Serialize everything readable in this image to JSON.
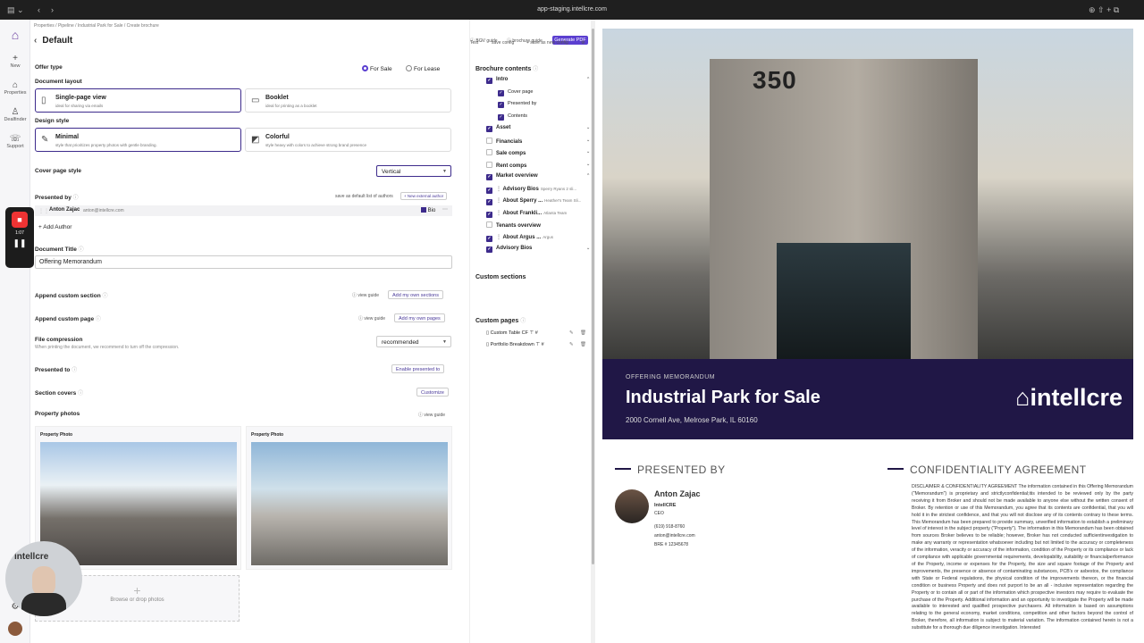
{
  "browser": {
    "url": "app-staging.intellcre.com"
  },
  "sidebar": {
    "items": [
      {
        "label": "New",
        "icon": "plus-icon"
      },
      {
        "label": "Properties",
        "icon": "house-icon"
      },
      {
        "label": "Dealfinder",
        "icon": "person-icon"
      },
      {
        "label": "Support",
        "icon": "support-icon"
      }
    ]
  },
  "recorder": {
    "time": "1:07"
  },
  "webcam": {
    "brand": "intellcre"
  },
  "breadcrumb": "Properties  /  Pipeline  /  Industrial Park for Sale  /  Create brochure",
  "title": "Default",
  "offer_type": {
    "label": "Offer type",
    "options": [
      "For Sale",
      "For Lease"
    ]
  },
  "document_layout": {
    "label": "Document layout",
    "options": [
      {
        "title": "Single-page view",
        "sub": "ideal for sharing via emails"
      },
      {
        "title": "Booklet",
        "sub": "ideal for printing as a booklet"
      }
    ]
  },
  "design_style": {
    "label": "Design style",
    "options": [
      {
        "title": "Minimal",
        "sub": "style that prioritizes property photos with gentle branding."
      },
      {
        "title": "Colorful",
        "sub": "style heavy with colors to achieve strong brand presence"
      }
    ]
  },
  "cover_page_style": {
    "label": "Cover page style",
    "value": "Vertical"
  },
  "presented_by": {
    "label": "Presented by",
    "save_default": "save as default list of authors",
    "new_external": "+ New external author",
    "author_name": "Anton Zajac",
    "author_email": "anton@intellcre.com",
    "bio": "Bio",
    "add_author": "+ Add Author"
  },
  "document_title": {
    "label": "Document Title",
    "value": "Offering Memorandum"
  },
  "append_section": {
    "label": "Append custom section",
    "guide": "view guide",
    "button": "Add my own sections"
  },
  "append_page": {
    "label": "Append custom page",
    "guide": "view guide",
    "button": "Add my own pages"
  },
  "file_compression": {
    "label": "File compression",
    "sub": "When printing the document, we recommend to turn off the compression.",
    "value": "recommended"
  },
  "presented_to": {
    "label": "Presented to",
    "button": "Enable presented to"
  },
  "section_covers": {
    "label": "Section covers",
    "button": "Customize"
  },
  "property_photos": {
    "label": "Property photos",
    "guide": "view guide",
    "photo_label": "Property Photo",
    "drop": "Browse or drop photos"
  },
  "toolbar": {
    "bov_guide": "BOV guide",
    "brochure_guide": "brochure guide",
    "generate": "Generate PDF",
    "test": "Test",
    "save_config": "save config",
    "save_new": "+ save as new config"
  },
  "contents": {
    "label": "Brochure contents",
    "items": [
      {
        "label": "Intro",
        "checked": true,
        "level": 0
      },
      {
        "label": "Cover page",
        "checked": true,
        "level": 1
      },
      {
        "label": "Presented by",
        "checked": true,
        "level": 1
      },
      {
        "label": "Contents",
        "checked": true,
        "level": 1
      },
      {
        "label": "Asset",
        "checked": true,
        "level": 0
      },
      {
        "label": "Financials",
        "checked": false,
        "level": 0
      },
      {
        "label": "Sale comps",
        "checked": false,
        "level": 0
      },
      {
        "label": "Rent comps",
        "checked": false,
        "level": 0
      },
      {
        "label": "Market overview",
        "checked": true,
        "level": 0
      },
      {
        "label": "Advisory Bios",
        "checked": true,
        "level": 0,
        "extra": "Sperry Ryans 2 sli..."
      },
      {
        "label": "About Sperry ...",
        "checked": true,
        "level": 0,
        "extra": "Heather's Team Sli..."
      },
      {
        "label": "About Frankli...",
        "checked": true,
        "level": 0,
        "extra": "Atlanta Team"
      },
      {
        "label": "Tenants overview",
        "checked": false,
        "level": 0
      },
      {
        "label": "About Argus ...",
        "checked": true,
        "level": 0,
        "extra": "Argus"
      },
      {
        "label": "Advisory Bios",
        "checked": true,
        "level": 0
      }
    ]
  },
  "custom_sections": {
    "label": "Custom sections"
  },
  "custom_pages": {
    "label": "Custom pages",
    "items": [
      "Custom Table CF",
      "Portfolio Breakdown"
    ]
  },
  "preview": {
    "building_number": "350",
    "offering": "OFFERING MEMORANDUM",
    "title": "Industrial Park for Sale",
    "address": "2000 Cornell Ave, Melrose Park, IL 60160",
    "brand": "intellcre",
    "presented_by": "PRESENTED BY",
    "confidentiality": "CONFIDENTIALITY AGREEMENT",
    "agent": {
      "name": "Anton Zajac",
      "company": "IntellCRE",
      "role": "CEO",
      "phone": "(619) 918-8760",
      "email": "anton@intellcre.com",
      "license": "BRE # 12345678"
    },
    "disclaimer": "DISCLAIMER & CONFIDENTIALITY AGREEMENT The information contained in this Offering Memorandum (\"Memorandum\") is proprietary and strictlyconfidential;itis intended to be reviewed only by the party receiving it from Broker and should not be made available to anyone else without the written consent of Broker. By retention or use of this Memorandum, you agree that its contents are confidential, that you will hold it in the strictest confidence, and that you will not disclose any of its contents contrary to these terms. This Memorandum has been prepared to provide summary, unverified information to establish a preliminary level of interest in the subject property (\"Property\"). The information in this Memorandum has been obtained from sources Broker believes to be reliable; however, Broker has not conducted sufficientinvestigation to make any warranty or representation whatsoever including but not limited to the accuracy or completeness of the information, veracity or accuracy of the information, condition of the Property or its compliance or lack of compliance with applicable governmental requirements, developability, suitability or financialperformance of the Property, income or expenses for the Property, the size and square footage of the Property and improvements, the presence or absence of contaminating substances, PCB's or asbestos, the compliance with State or Federal regulations, the physical condition of the improvements thereon, or the financial condition or business Property and does not purport to be an all - inclusive representation regarding the Property or to contain all or part of the information which prospective investors may require to evaluate the purchase of the Property. Additional information and an opportunity to investigate the Property will be made available to interested and qualified prospective purchasers. All information is based on assumptions relating to the general economy, market conditions, competition and other factors beyond the control of Broker, therefore, all information is subject to material variation. The information contained herein is not a substitute for a thorough due diligence investigation. Interested"
  }
}
